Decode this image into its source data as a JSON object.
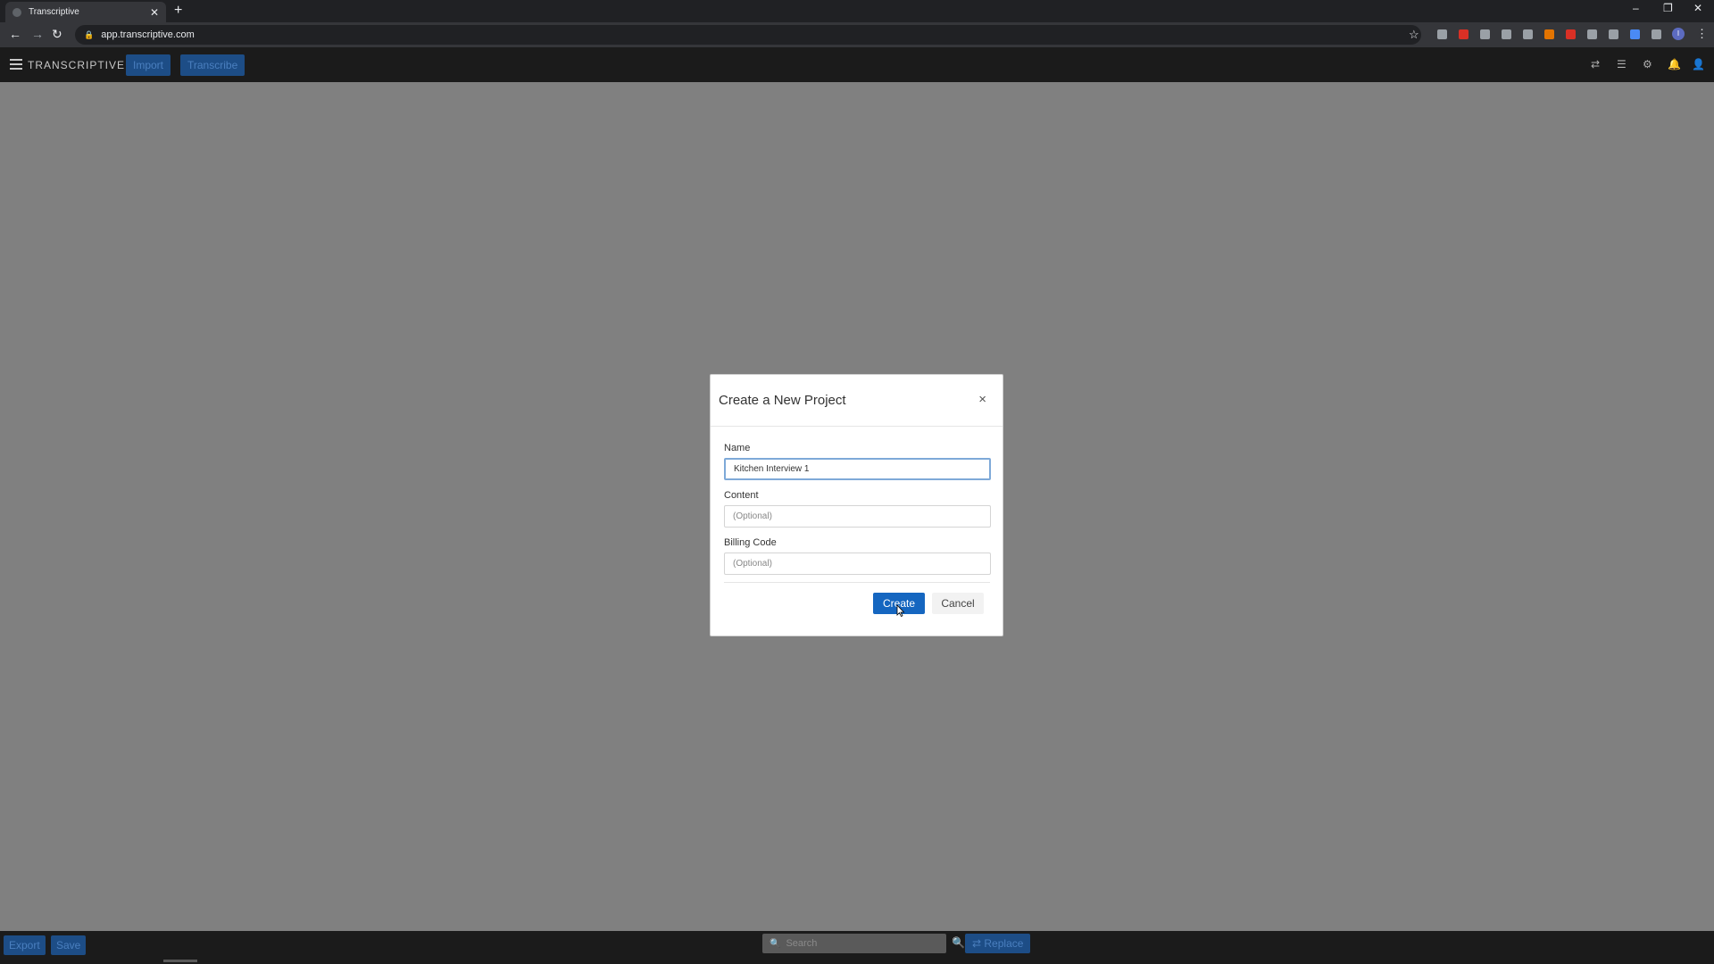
{
  "browser": {
    "tab_title": "Transcriptive",
    "tab_close": "✕",
    "new_tab": "+",
    "url": "app.transcriptive.com",
    "window_controls": {
      "minimize": "–",
      "restore": "❐",
      "close": "✕"
    },
    "profile_initial": "I"
  },
  "app": {
    "brand": "TRANSCRIPTIVE",
    "import_label": "Import",
    "transcribe_label": "Transcribe"
  },
  "modal": {
    "title": "Create a New Project",
    "close": "×",
    "name_label": "Name",
    "name_value": "Kitchen Interview 1",
    "content_label": "Content",
    "content_placeholder": "(Optional)",
    "billing_label": "Billing Code",
    "billing_placeholder": "(Optional)",
    "create_label": "Create",
    "cancel_label": "Cancel"
  },
  "bottom": {
    "export_label": "Export",
    "save_label": "Save",
    "search_placeholder": "Search",
    "replace_label": "Replace"
  }
}
